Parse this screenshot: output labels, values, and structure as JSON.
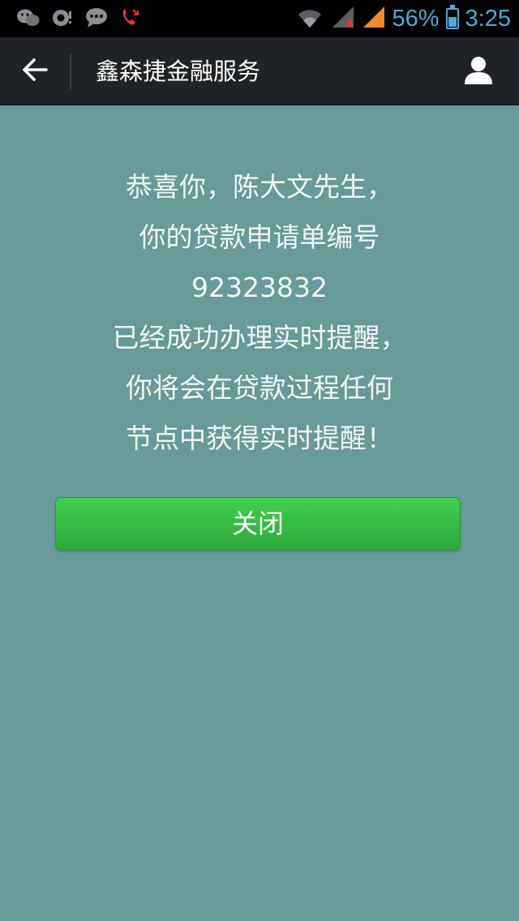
{
  "status_bar": {
    "battery_percent_text": "56%",
    "time": "3:25",
    "battery_level": 0.56,
    "icons": [
      "wechat-icon",
      "camera-icon",
      "chat-bubble-icon",
      "missed-call-icon",
      "wifi-icon",
      "signal-icon",
      "signal-icon",
      "battery-icon"
    ]
  },
  "header": {
    "title": "鑫森捷金融服务",
    "back_icon": "back-arrow-icon",
    "profile_icon": "profile-icon"
  },
  "message": {
    "lines": [
      "恭喜你，陈大文先生，",
      "你的贷款申请单编号",
      "92323832",
      "已经成功办理实时提醒，",
      "你将会在贷款过程任何",
      "节点中获得实时提醒！"
    ]
  },
  "actions": {
    "close_label": "关闭"
  },
  "colors": {
    "background": "#679a99",
    "status_text": "#4fa9d6",
    "title_bar": "#1f2326",
    "button": "#35bd45"
  }
}
